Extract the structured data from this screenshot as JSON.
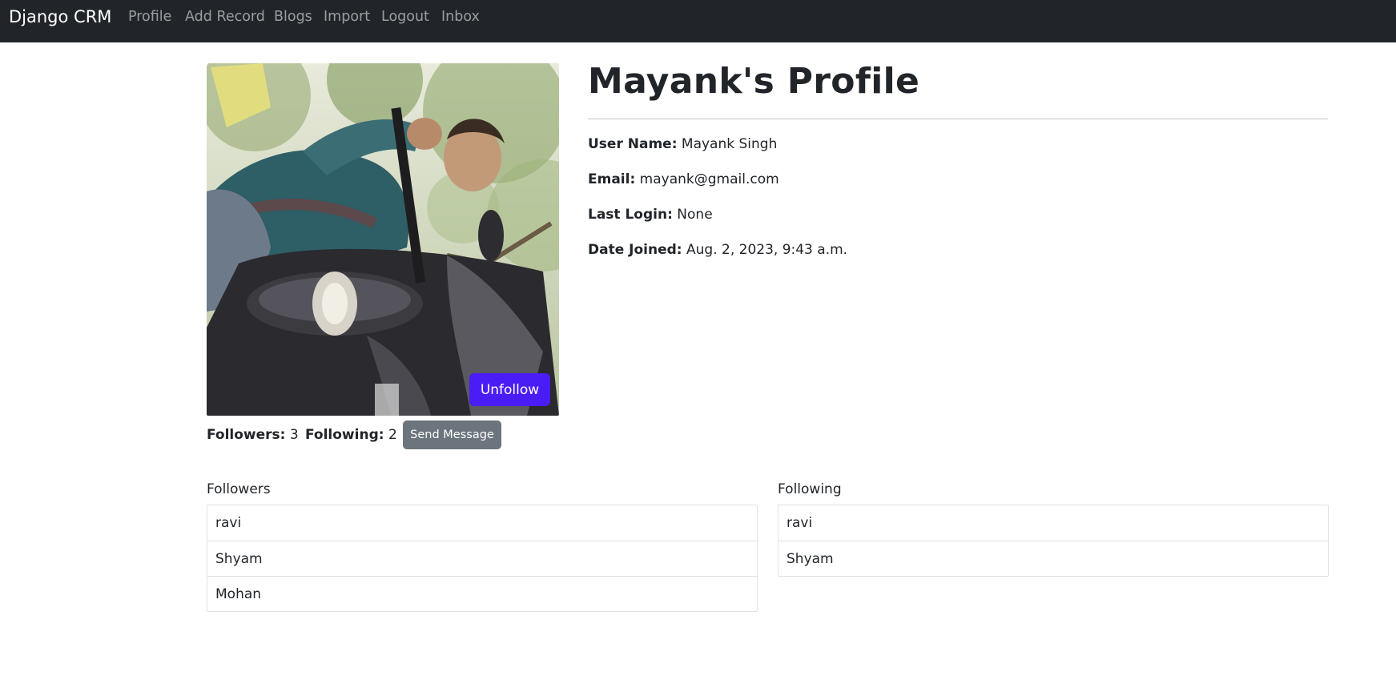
{
  "navbar": {
    "brand": "Django CRM",
    "links": [
      "Profile",
      "Add Record",
      "Blogs",
      "Import",
      "Logout",
      "Inbox"
    ]
  },
  "profile": {
    "title": "Mayank's Profile",
    "fields": [
      {
        "label": "User Name:",
        "value": "Mayank Singh"
      },
      {
        "label": "Email:",
        "value": "mayank@gmail.com"
      },
      {
        "label": "Last Login:",
        "value": "None"
      },
      {
        "label": "Date Joined:",
        "value": "Aug. 2, 2023, 9:43 a.m."
      }
    ],
    "unfollow_label": "Unfollow"
  },
  "stats": {
    "followers_label": "Followers:",
    "followers_count": "3",
    "following_label": "Following:",
    "following_count": "2",
    "send_message_label": "Send Message"
  },
  "followers": {
    "title": "Followers",
    "items": [
      "ravi",
      "Shyam",
      "Mohan"
    ]
  },
  "following": {
    "title": "Following",
    "items": [
      "ravi",
      "Shyam"
    ]
  },
  "colors": {
    "navbar_bg": "#212529",
    "unfollow_bg": "#4a1cf6",
    "secondary_btn": "#6c757d"
  }
}
